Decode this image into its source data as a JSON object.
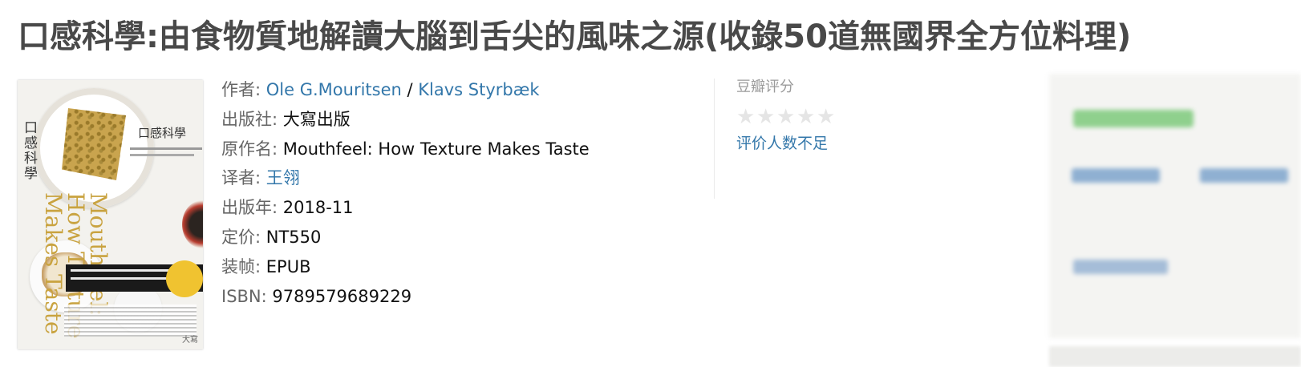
{
  "book": {
    "title": "口感科學:由食物質地解讀大腦到舌尖的風味之源(收錄50道無國界全方位料理)",
    "cover": {
      "vertical_title": "口感科學",
      "cover_title": "口感科學",
      "english_title": "Mouthfeel: How Texture Makes Taste",
      "publisher_mark": "大寫"
    },
    "info": {
      "author_label": "作者: ",
      "authors": [
        "Ole G.Mouritsen",
        "Klavs Styrbæk"
      ],
      "author_sep": " / ",
      "publisher_label": "出版社: ",
      "publisher": "大寫出版",
      "original_label": "原作名: ",
      "original": "Mouthfeel: How Texture Makes Taste",
      "translator_label": "译者: ",
      "translator": "王翎",
      "year_label": "出版年: ",
      "year": "2018-11",
      "price_label": "定价: ",
      "price": "NT550",
      "binding_label": "装帧: ",
      "binding": "EPUB",
      "isbn_label": "ISBN: ",
      "isbn": "9789579689229"
    },
    "rating": {
      "label": "豆瓣评分",
      "stars_filled": 0,
      "stars_total": 5,
      "insufficient_text": "评价人数不足"
    }
  }
}
